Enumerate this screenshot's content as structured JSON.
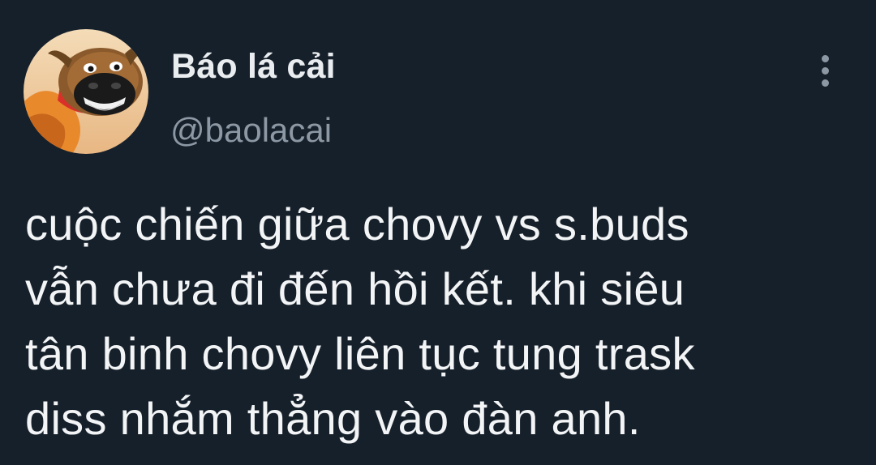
{
  "tweet": {
    "author": {
      "display_name": "Báo lá cải",
      "handle": "@baolacai",
      "avatar_icon": "cartoon-buffalo-avatar"
    },
    "more_icon": "more-vertical-icon",
    "text_lines": [
      "cuộc chiến giữa chovy vs s.buds",
      "vẫn chưa đi đến hồi kết. khi siêu",
      "tân binh chovy liên tục tung trask",
      "diss nhắm thẳng vào đàn anh."
    ]
  },
  "colors": {
    "background": "#16202b",
    "primary_text": "#f2f4f5",
    "secondary_text": "#8c98a4"
  }
}
